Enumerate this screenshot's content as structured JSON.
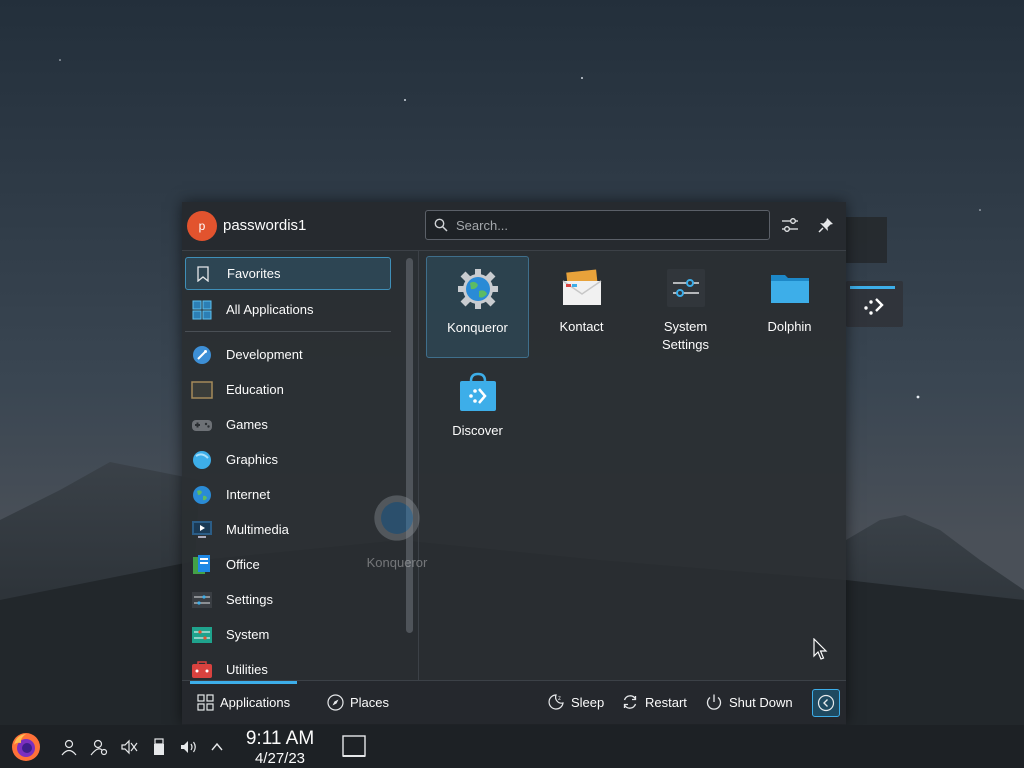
{
  "user": {
    "initial": "p",
    "name": "passwordis1"
  },
  "search": {
    "placeholder": "Search..."
  },
  "sidebar": {
    "items": [
      {
        "label": "Favorites",
        "icon": "bookmark-icon"
      },
      {
        "label": "All Applications",
        "icon": "all-apps-icon"
      },
      {
        "label": "Development",
        "icon": "development-icon"
      },
      {
        "label": "Education",
        "icon": "education-icon"
      },
      {
        "label": "Games",
        "icon": "gamepad-icon"
      },
      {
        "label": "Graphics",
        "icon": "graphics-icon"
      },
      {
        "label": "Internet",
        "icon": "globe-icon"
      },
      {
        "label": "Multimedia",
        "icon": "multimedia-icon"
      },
      {
        "label": "Office",
        "icon": "office-icon"
      },
      {
        "label": "Settings",
        "icon": "settings-icon"
      },
      {
        "label": "System",
        "icon": "system-icon"
      },
      {
        "label": "Utilities",
        "icon": "utilities-icon"
      }
    ]
  },
  "favorites": [
    {
      "label": "Konqueror",
      "icon": "konqueror-icon"
    },
    {
      "label": "Kontact",
      "icon": "kontact-icon"
    },
    {
      "label": "System Settings",
      "icon": "system-settings-icon"
    },
    {
      "label": "Dolphin",
      "icon": "dolphin-folder-icon"
    },
    {
      "label": "Discover",
      "icon": "discover-icon"
    }
  ],
  "drag_ghost": {
    "label": "Konqueror"
  },
  "footer": {
    "tabs": [
      {
        "label": "Applications"
      },
      {
        "label": "Places"
      }
    ],
    "power": [
      {
        "label": "Sleep"
      },
      {
        "label": "Restart"
      },
      {
        "label": "Shut Down"
      }
    ]
  },
  "taskbar": {
    "time": "9:11 AM",
    "date": "4/27/23"
  },
  "colors": {
    "accent": "#3daee9",
    "avatar": "#e2532e",
    "panel": "#2a2e32"
  }
}
